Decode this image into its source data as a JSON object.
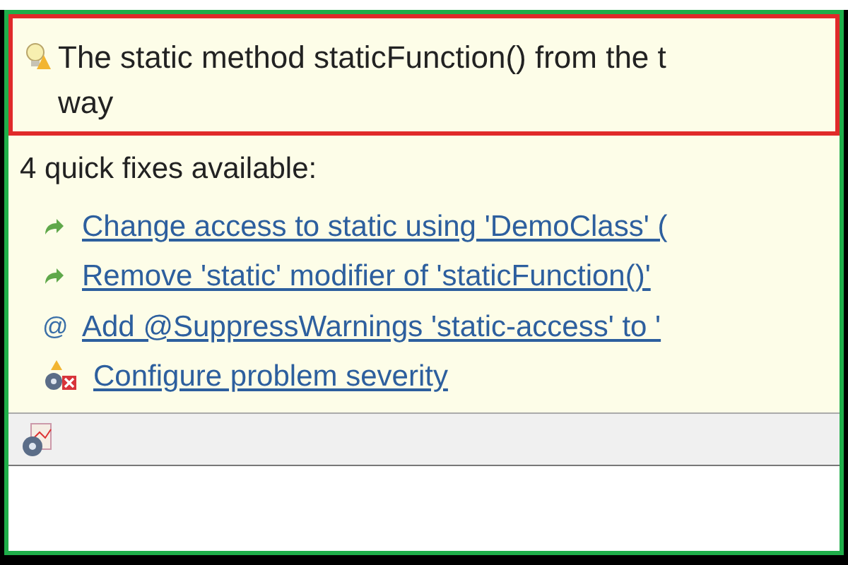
{
  "problem": {
    "message_line_1": "The static method staticFunction() from the t",
    "message_line_2": "way"
  },
  "quick_fixes": {
    "heading": "4 quick fixes available:",
    "items": [
      {
        "kind": "change",
        "label": "Change access to static using 'DemoClass' ("
      },
      {
        "kind": "change",
        "label": "Remove 'static' modifier of 'staticFunction()'"
      },
      {
        "kind": "annotation",
        "glyph": "@",
        "label": "Add @SuppressWarnings 'static-access' to '"
      },
      {
        "kind": "configure",
        "label": "Configure problem severity"
      }
    ]
  }
}
